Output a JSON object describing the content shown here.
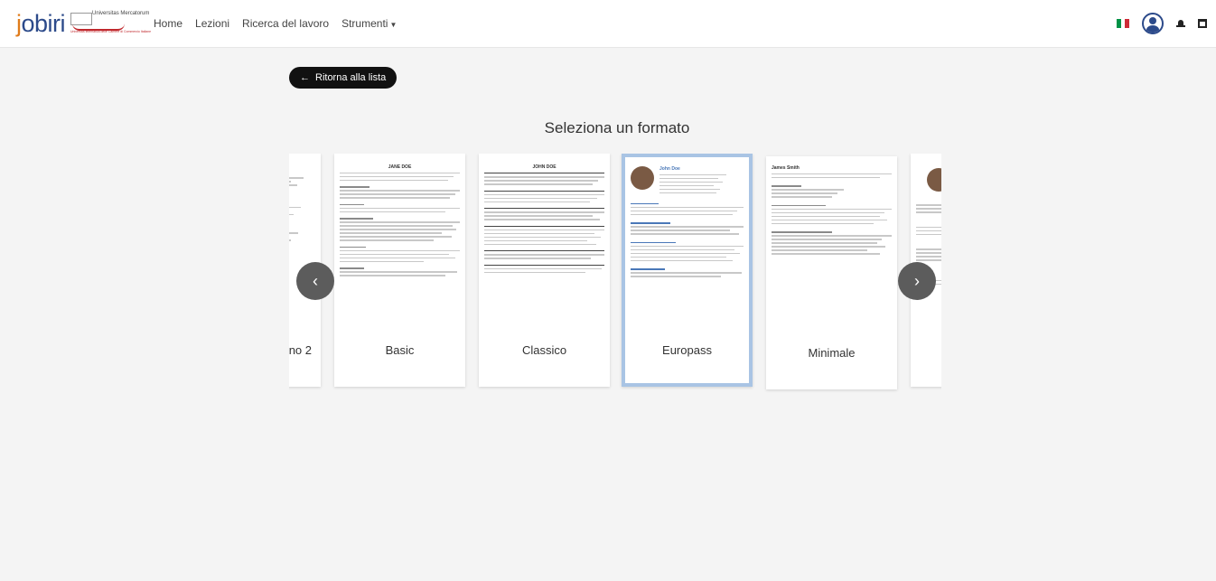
{
  "header": {
    "logo_text": "jobiri",
    "uni_name": "Universitas Mercatorum",
    "uni_sub": "Università telematica delle Camere di Commercio Italiane",
    "nav": [
      {
        "label": "Home"
      },
      {
        "label": "Lezioni"
      },
      {
        "label": "Ricerca del lavoro"
      },
      {
        "label": "Strumenti"
      }
    ],
    "icons": [
      "italian-flag-icon",
      "user-avatar-icon",
      "bell-icon",
      "calendar-icon"
    ],
    "flag_colors": [
      "#009246",
      "#ffffff",
      "#ce2b37"
    ]
  },
  "back_button": {
    "label": "Ritorna alla lista",
    "icon": "arrow-left-icon"
  },
  "page_title": "Seleziona un formato",
  "formats": [
    {
      "label": "no 2",
      "selected": false
    },
    {
      "label": "Basic",
      "selected": false,
      "preview_name": "JANE DOE"
    },
    {
      "label": "Classico",
      "selected": false,
      "preview_name": "JOHN DOE"
    },
    {
      "label": "Europass",
      "selected": true,
      "preview_name": "John Doe"
    },
    {
      "label": "Minimale",
      "selected": false,
      "preview_name": "James Smith"
    },
    {
      "label": "",
      "selected": false
    }
  ],
  "carousel": {
    "prev_icon": "chevron-left-icon",
    "next_icon": "chevron-right-icon"
  },
  "colors": {
    "accent": "#2c4a8a",
    "button_bg": "#111111",
    "selected_border": "#a9c4e4"
  }
}
